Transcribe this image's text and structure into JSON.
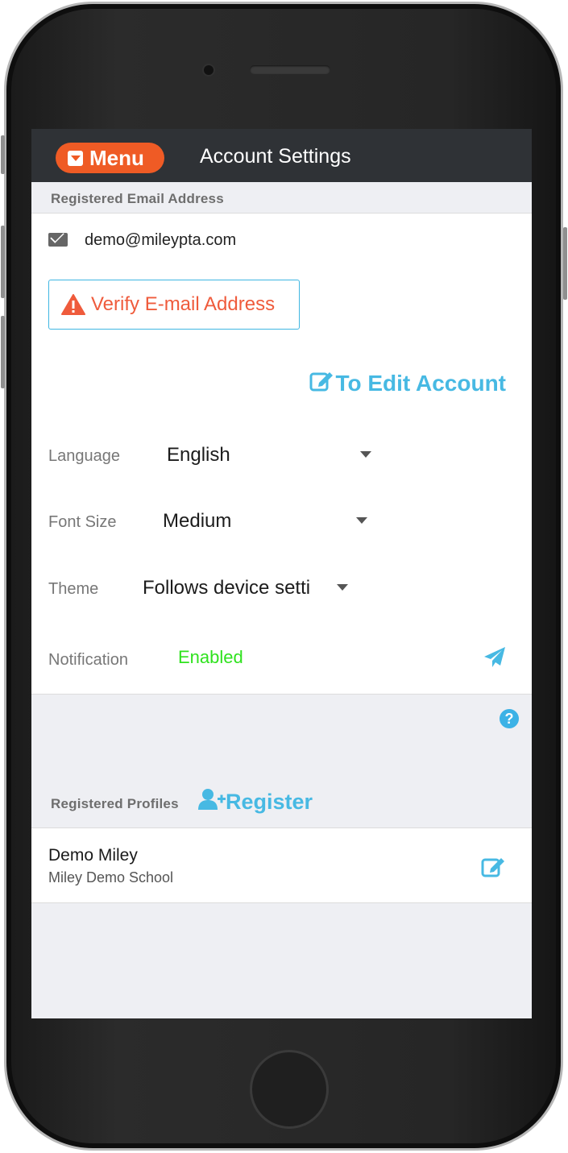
{
  "header": {
    "menu_label": "Menu",
    "title": "Account Settings"
  },
  "email_section": {
    "label": "Registered Email Address",
    "email": "demo@mileypta.com",
    "verify_button": "Verify E-mail Address",
    "edit_account_link": "To Edit Account"
  },
  "settings": {
    "language": {
      "label": "Language",
      "value": "English"
    },
    "font_size": {
      "label": "Font Size",
      "value": "Medium"
    },
    "theme": {
      "label": "Theme",
      "value": "Follows device setti"
    },
    "notification": {
      "label": "Notification",
      "value": "Enabled"
    }
  },
  "profiles_section": {
    "label": "Registered Profiles",
    "register_link": "Register",
    "profiles": [
      {
        "name": "Demo Miley",
        "school": "Miley Demo School"
      }
    ]
  },
  "colors": {
    "accent_orange": "#ef5b25",
    "link_blue": "#47b9e3",
    "enabled_green": "#2fe21e",
    "header_bg": "#2f3236"
  },
  "icons": [
    "menu-caret-icon",
    "mail-icon",
    "warning-icon",
    "edit-icon",
    "send-icon",
    "help-icon",
    "add-user-icon"
  ]
}
